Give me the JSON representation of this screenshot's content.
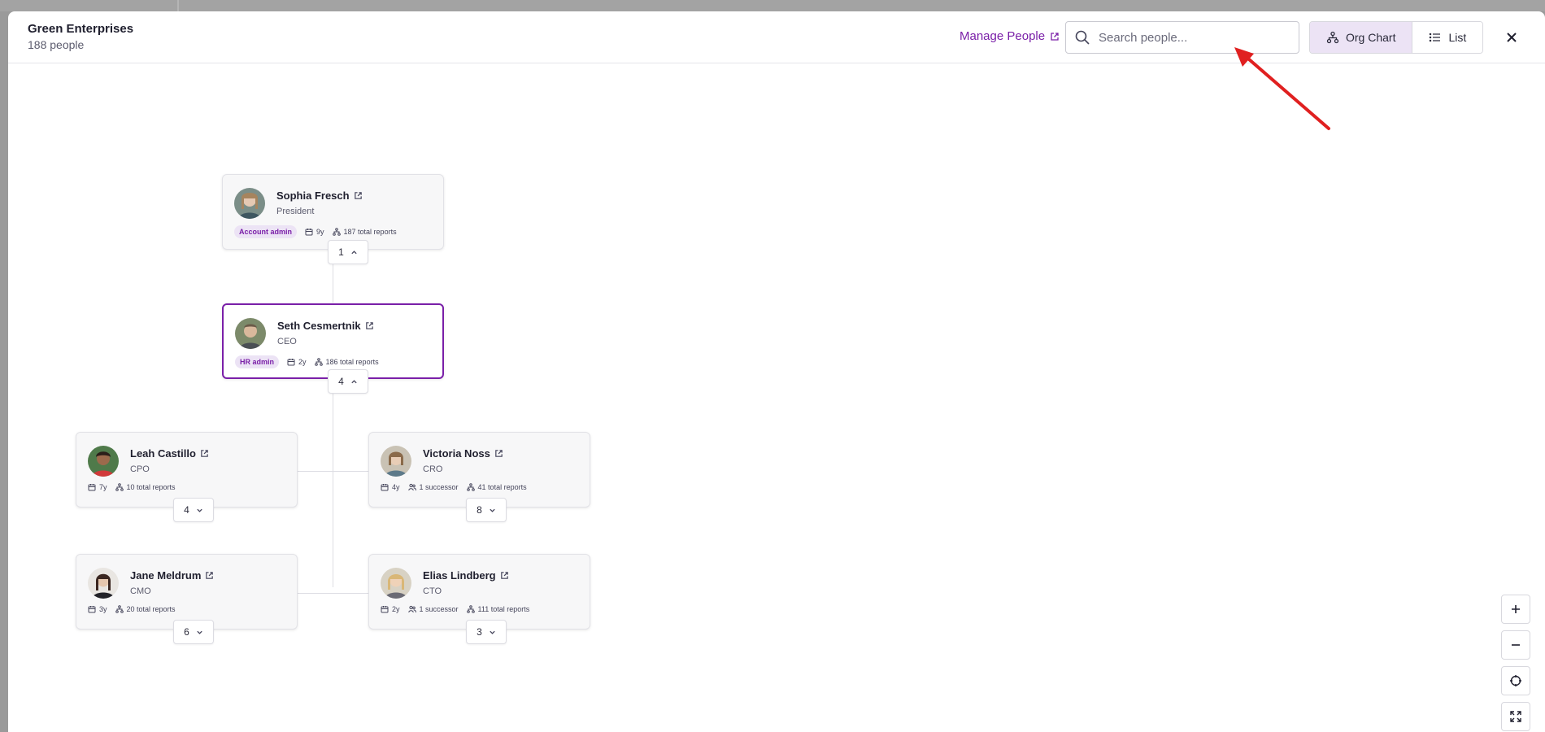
{
  "header": {
    "org_name": "Green Enterprises",
    "people_count": "188 people",
    "manage_link": "Manage People",
    "search_placeholder": "Search people...",
    "view_org_chart": "Org Chart",
    "view_list": "List"
  },
  "colors": {
    "accent": "#7a1fa8",
    "accent_bg": "#ece3f5",
    "annotation": "#e02020"
  },
  "people": {
    "sophia": {
      "name": "Sophia Fresch",
      "role": "President",
      "badge": "Account admin",
      "tenure": "9y",
      "reports": "187 total reports",
      "children_count": "1",
      "chevron": "up"
    },
    "seth": {
      "name": "Seth Cesmertnik",
      "role": "CEO",
      "badge": "HR admin",
      "tenure": "2y",
      "reports": "186 total reports",
      "children_count": "4",
      "chevron": "up",
      "selected": true
    },
    "leah": {
      "name": "Leah Castillo",
      "role": "CPO",
      "tenure": "7y",
      "reports": "10 total reports",
      "children_count": "4",
      "chevron": "down"
    },
    "victoria": {
      "name": "Victoria Noss",
      "role": "CRO",
      "tenure": "4y",
      "successors": "1 successor",
      "reports": "41 total reports",
      "children_count": "8",
      "chevron": "down"
    },
    "jane": {
      "name": "Jane Meldrum",
      "role": "CMO",
      "tenure": "3y",
      "reports": "20 total reports",
      "children_count": "6",
      "chevron": "down"
    },
    "elias": {
      "name": "Elias Lindberg",
      "role": "CTO",
      "tenure": "2y",
      "successors": "1 successor",
      "reports": "111 total reports",
      "children_count": "3",
      "chevron": "down"
    }
  },
  "icons": {
    "external": "external-link-icon",
    "calendar": "calendar-icon",
    "hierarchy": "hierarchy-icon",
    "users": "users-icon",
    "zoom_in": "plus-icon",
    "zoom_out": "minus-icon",
    "recenter": "crosshair-icon",
    "fit": "fit-screen-icon",
    "close": "close-icon",
    "search": "search-icon"
  }
}
